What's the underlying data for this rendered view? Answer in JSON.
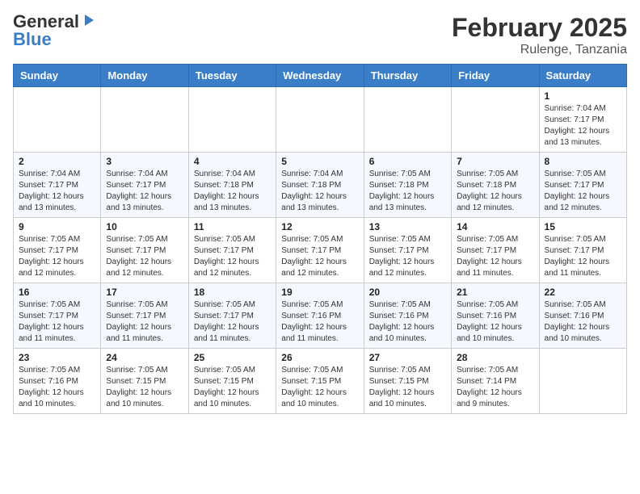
{
  "header": {
    "logo_general": "General",
    "logo_blue": "Blue",
    "month_title": "February 2025",
    "location": "Rulenge, Tanzania"
  },
  "calendar": {
    "days_of_week": [
      "Sunday",
      "Monday",
      "Tuesday",
      "Wednesday",
      "Thursday",
      "Friday",
      "Saturday"
    ],
    "weeks": [
      [
        {
          "day": "",
          "info": ""
        },
        {
          "day": "",
          "info": ""
        },
        {
          "day": "",
          "info": ""
        },
        {
          "day": "",
          "info": ""
        },
        {
          "day": "",
          "info": ""
        },
        {
          "day": "",
          "info": ""
        },
        {
          "day": "1",
          "info": "Sunrise: 7:04 AM\nSunset: 7:17 PM\nDaylight: 12 hours\nand 13 minutes."
        }
      ],
      [
        {
          "day": "2",
          "info": "Sunrise: 7:04 AM\nSunset: 7:17 PM\nDaylight: 12 hours\nand 13 minutes."
        },
        {
          "day": "3",
          "info": "Sunrise: 7:04 AM\nSunset: 7:17 PM\nDaylight: 12 hours\nand 13 minutes."
        },
        {
          "day": "4",
          "info": "Sunrise: 7:04 AM\nSunset: 7:18 PM\nDaylight: 12 hours\nand 13 minutes."
        },
        {
          "day": "5",
          "info": "Sunrise: 7:04 AM\nSunset: 7:18 PM\nDaylight: 12 hours\nand 13 minutes."
        },
        {
          "day": "6",
          "info": "Sunrise: 7:05 AM\nSunset: 7:18 PM\nDaylight: 12 hours\nand 13 minutes."
        },
        {
          "day": "7",
          "info": "Sunrise: 7:05 AM\nSunset: 7:18 PM\nDaylight: 12 hours\nand 12 minutes."
        },
        {
          "day": "8",
          "info": "Sunrise: 7:05 AM\nSunset: 7:17 PM\nDaylight: 12 hours\nand 12 minutes."
        }
      ],
      [
        {
          "day": "9",
          "info": "Sunrise: 7:05 AM\nSunset: 7:17 PM\nDaylight: 12 hours\nand 12 minutes."
        },
        {
          "day": "10",
          "info": "Sunrise: 7:05 AM\nSunset: 7:17 PM\nDaylight: 12 hours\nand 12 minutes."
        },
        {
          "day": "11",
          "info": "Sunrise: 7:05 AM\nSunset: 7:17 PM\nDaylight: 12 hours\nand 12 minutes."
        },
        {
          "day": "12",
          "info": "Sunrise: 7:05 AM\nSunset: 7:17 PM\nDaylight: 12 hours\nand 12 minutes."
        },
        {
          "day": "13",
          "info": "Sunrise: 7:05 AM\nSunset: 7:17 PM\nDaylight: 12 hours\nand 12 minutes."
        },
        {
          "day": "14",
          "info": "Sunrise: 7:05 AM\nSunset: 7:17 PM\nDaylight: 12 hours\nand 11 minutes."
        },
        {
          "day": "15",
          "info": "Sunrise: 7:05 AM\nSunset: 7:17 PM\nDaylight: 12 hours\nand 11 minutes."
        }
      ],
      [
        {
          "day": "16",
          "info": "Sunrise: 7:05 AM\nSunset: 7:17 PM\nDaylight: 12 hours\nand 11 minutes."
        },
        {
          "day": "17",
          "info": "Sunrise: 7:05 AM\nSunset: 7:17 PM\nDaylight: 12 hours\nand 11 minutes."
        },
        {
          "day": "18",
          "info": "Sunrise: 7:05 AM\nSunset: 7:17 PM\nDaylight: 12 hours\nand 11 minutes."
        },
        {
          "day": "19",
          "info": "Sunrise: 7:05 AM\nSunset: 7:16 PM\nDaylight: 12 hours\nand 11 minutes."
        },
        {
          "day": "20",
          "info": "Sunrise: 7:05 AM\nSunset: 7:16 PM\nDaylight: 12 hours\nand 10 minutes."
        },
        {
          "day": "21",
          "info": "Sunrise: 7:05 AM\nSunset: 7:16 PM\nDaylight: 12 hours\nand 10 minutes."
        },
        {
          "day": "22",
          "info": "Sunrise: 7:05 AM\nSunset: 7:16 PM\nDaylight: 12 hours\nand 10 minutes."
        }
      ],
      [
        {
          "day": "23",
          "info": "Sunrise: 7:05 AM\nSunset: 7:16 PM\nDaylight: 12 hours\nand 10 minutes."
        },
        {
          "day": "24",
          "info": "Sunrise: 7:05 AM\nSunset: 7:15 PM\nDaylight: 12 hours\nand 10 minutes."
        },
        {
          "day": "25",
          "info": "Sunrise: 7:05 AM\nSunset: 7:15 PM\nDaylight: 12 hours\nand 10 minutes."
        },
        {
          "day": "26",
          "info": "Sunrise: 7:05 AM\nSunset: 7:15 PM\nDaylight: 12 hours\nand 10 minutes."
        },
        {
          "day": "27",
          "info": "Sunrise: 7:05 AM\nSunset: 7:15 PM\nDaylight: 12 hours\nand 10 minutes."
        },
        {
          "day": "28",
          "info": "Sunrise: 7:05 AM\nSunset: 7:14 PM\nDaylight: 12 hours\nand 9 minutes."
        },
        {
          "day": "",
          "info": ""
        }
      ]
    ]
  }
}
